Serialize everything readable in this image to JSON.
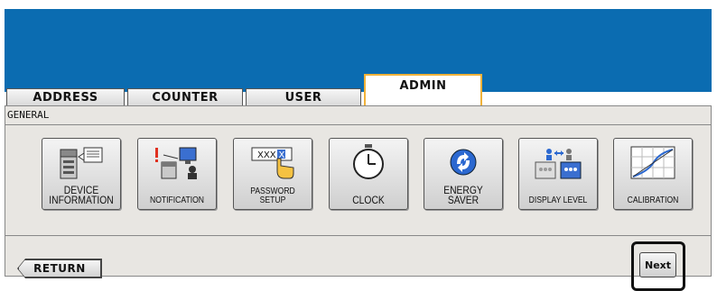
{
  "tabs": [
    {
      "label": "ADDRESS",
      "active": false
    },
    {
      "label": "COUNTER",
      "active": false
    },
    {
      "label": "USER",
      "active": false
    },
    {
      "label": "ADMIN",
      "active": true
    }
  ],
  "section": {
    "label": "GENERAL"
  },
  "buttons": [
    {
      "label": "DEVICE\nINFORMATION",
      "icon": "device-icon"
    },
    {
      "label": "NOTIFICATION",
      "icon": "notification-icon"
    },
    {
      "label": "PASSWORD SETUP",
      "icon": "password-icon"
    },
    {
      "label": "CLOCK",
      "icon": "clock-icon"
    },
    {
      "label": "ENERGY\nSAVER",
      "icon": "energy-saver-icon"
    },
    {
      "label": "DISPLAY LEVEL",
      "icon": "display-level-icon"
    },
    {
      "label": "CALIBRATION",
      "icon": "calibration-icon"
    }
  ],
  "password_icon_text": "XXX",
  "password_icon_highlight": "X",
  "footer": {
    "return_label": "RETURN",
    "next_label": "Next"
  },
  "colors": {
    "topbar": "#0b6cb1",
    "active_tab_border": "#f0b23a",
    "panel": "#e8e6e2"
  }
}
